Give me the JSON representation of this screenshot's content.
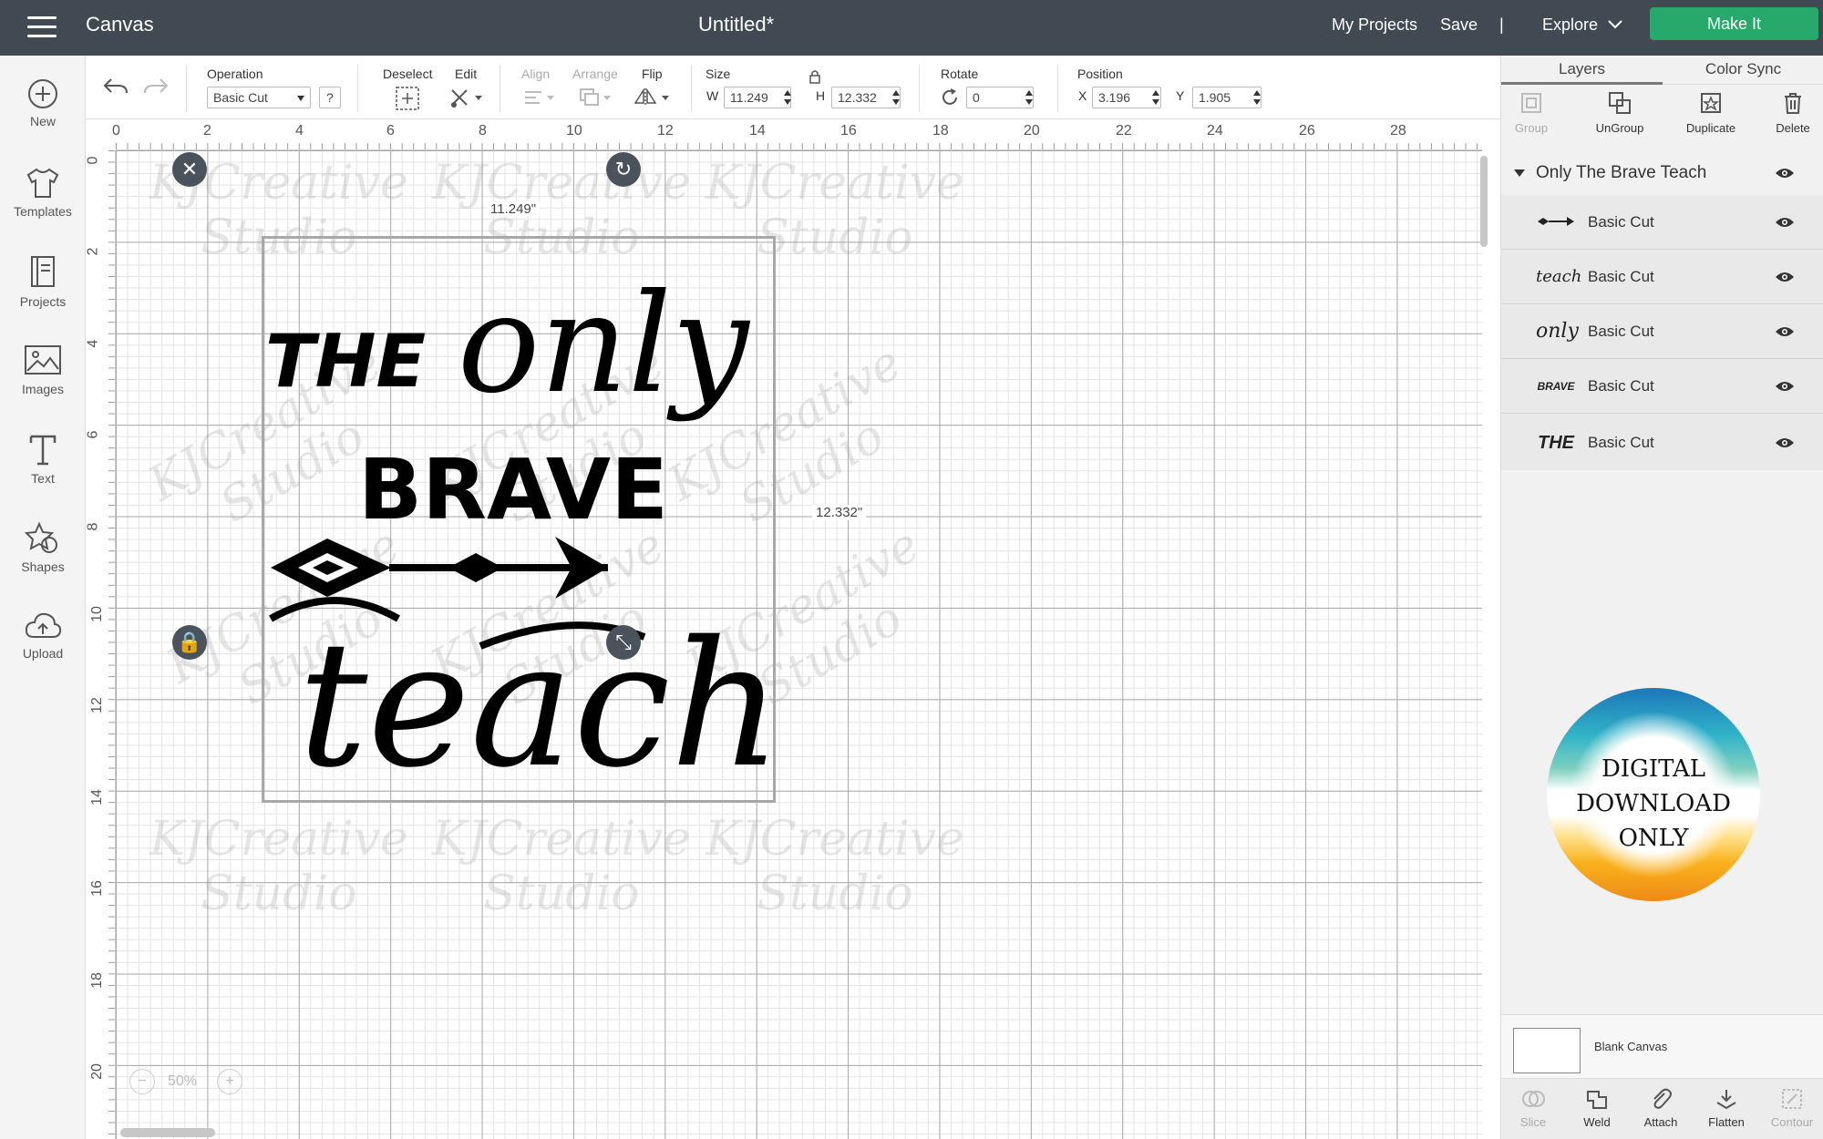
{
  "header": {
    "app_name": "Canvas",
    "document_title": "Untitled*",
    "my_projects": "My Projects",
    "save": "Save",
    "divider": "|",
    "explore": "Explore",
    "make_it": "Make It"
  },
  "sidebar": {
    "items": [
      {
        "label": "New",
        "icon": "plus-circle-icon"
      },
      {
        "label": "Templates",
        "icon": "tshirt-icon"
      },
      {
        "label": "Projects",
        "icon": "projects-icon"
      },
      {
        "label": "Images",
        "icon": "image-icon"
      },
      {
        "label": "Text",
        "icon": "text-icon"
      },
      {
        "label": "Shapes",
        "icon": "shapes-icon"
      },
      {
        "label": "Upload",
        "icon": "upload-cloud-icon"
      }
    ]
  },
  "toolbar": {
    "operation_label": "Operation",
    "operation_value": "Basic Cut",
    "help": "?",
    "deselect_label": "Deselect",
    "edit_label": "Edit",
    "align_label": "Align",
    "arrange_label": "Arrange",
    "flip_label": "Flip",
    "size_label": "Size",
    "w_label": "W",
    "w_value": "11.249",
    "h_label": "H",
    "h_value": "12.332",
    "rotate_label": "Rotate",
    "rotate_value": "0",
    "position_label": "Position",
    "x_label": "X",
    "x_value": "3.196",
    "y_label": "Y",
    "y_value": "1.905"
  },
  "canvas": {
    "ruler_top": [
      "0",
      "2",
      "4",
      "6",
      "8",
      "10",
      "12",
      "14",
      "16",
      "18",
      "20",
      "22",
      "24",
      "26",
      "28"
    ],
    "ruler_left": [
      "0",
      "2",
      "4",
      "6",
      "8",
      "10",
      "12",
      "14",
      "16",
      "18",
      "20"
    ],
    "width_dimension": "11.249\"",
    "height_dimension": "12.332\"",
    "zoom": "50%",
    "design_words": {
      "the": "THE",
      "only": "only",
      "brave": "BRAVE",
      "teach": "teach"
    },
    "watermark": "KJCreative\nStudio"
  },
  "panel": {
    "tabs": [
      "Layers",
      "Color Sync"
    ],
    "actions": [
      {
        "label": "Group",
        "enabled": false
      },
      {
        "label": "UnGroup",
        "enabled": true
      },
      {
        "label": "Duplicate",
        "enabled": true
      },
      {
        "label": "Delete",
        "enabled": true
      }
    ],
    "group_name": "Only The Brave Teach",
    "layers": [
      {
        "name": "Basic Cut",
        "thumb": "arrow"
      },
      {
        "name": "Basic Cut",
        "thumb": "teach"
      },
      {
        "name": "Basic Cut",
        "thumb": "only"
      },
      {
        "name": "Basic Cut",
        "thumb": "BRAVE"
      },
      {
        "name": "Basic Cut",
        "thumb": "THE"
      }
    ],
    "badge_lines": [
      "DIGITAL",
      "DOWNLOAD",
      "ONLY"
    ],
    "blank_canvas": "Blank Canvas",
    "bottom_actions": [
      {
        "label": "Slice",
        "enabled": false
      },
      {
        "label": "Weld",
        "enabled": true
      },
      {
        "label": "Attach",
        "enabled": true
      },
      {
        "label": "Flatten",
        "enabled": true
      },
      {
        "label": "Contour",
        "enabled": false
      }
    ]
  },
  "colors": {
    "header_bg": "#414a52",
    "make_it_green": "#27a96b",
    "handle_dark": "#4a535b"
  }
}
